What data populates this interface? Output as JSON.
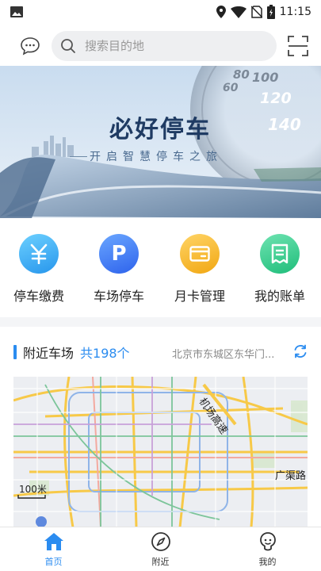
{
  "status_bar": {
    "time": "11:15"
  },
  "header": {
    "search_placeholder": "搜索目的地"
  },
  "banner": {
    "title": "必好停车",
    "subtitle": "开启智慧停车之旅",
    "speedometer": [
      "60",
      "80",
      "100",
      "120",
      "140"
    ]
  },
  "quick_actions": [
    {
      "label": "停车缴费",
      "symbol": "羊",
      "icon": "yen-icon",
      "color": "#2fa9f5"
    },
    {
      "label": "车场停车",
      "symbol": "P",
      "icon": "parking-icon",
      "color": "#3f7df2"
    },
    {
      "label": "月卡管理",
      "symbol": "",
      "icon": "card-icon",
      "color": "#f5b41c"
    },
    {
      "label": "我的账单",
      "symbol": "",
      "icon": "bill-icon",
      "color": "#2dc98a"
    }
  ],
  "nearby": {
    "title": "附近车场",
    "count_text": "共198个",
    "address": "北京市东城区东华门..."
  },
  "map": {
    "scale_label": "100米",
    "labels": [
      "机场高速",
      "广渠路"
    ]
  },
  "tabs": [
    {
      "label": "首页",
      "icon": "home-icon",
      "active": true
    },
    {
      "label": "附近",
      "icon": "compass-icon",
      "active": false
    },
    {
      "label": "我的",
      "icon": "user-icon",
      "active": false
    }
  ],
  "colors": {
    "accent": "#2b8cf0"
  }
}
